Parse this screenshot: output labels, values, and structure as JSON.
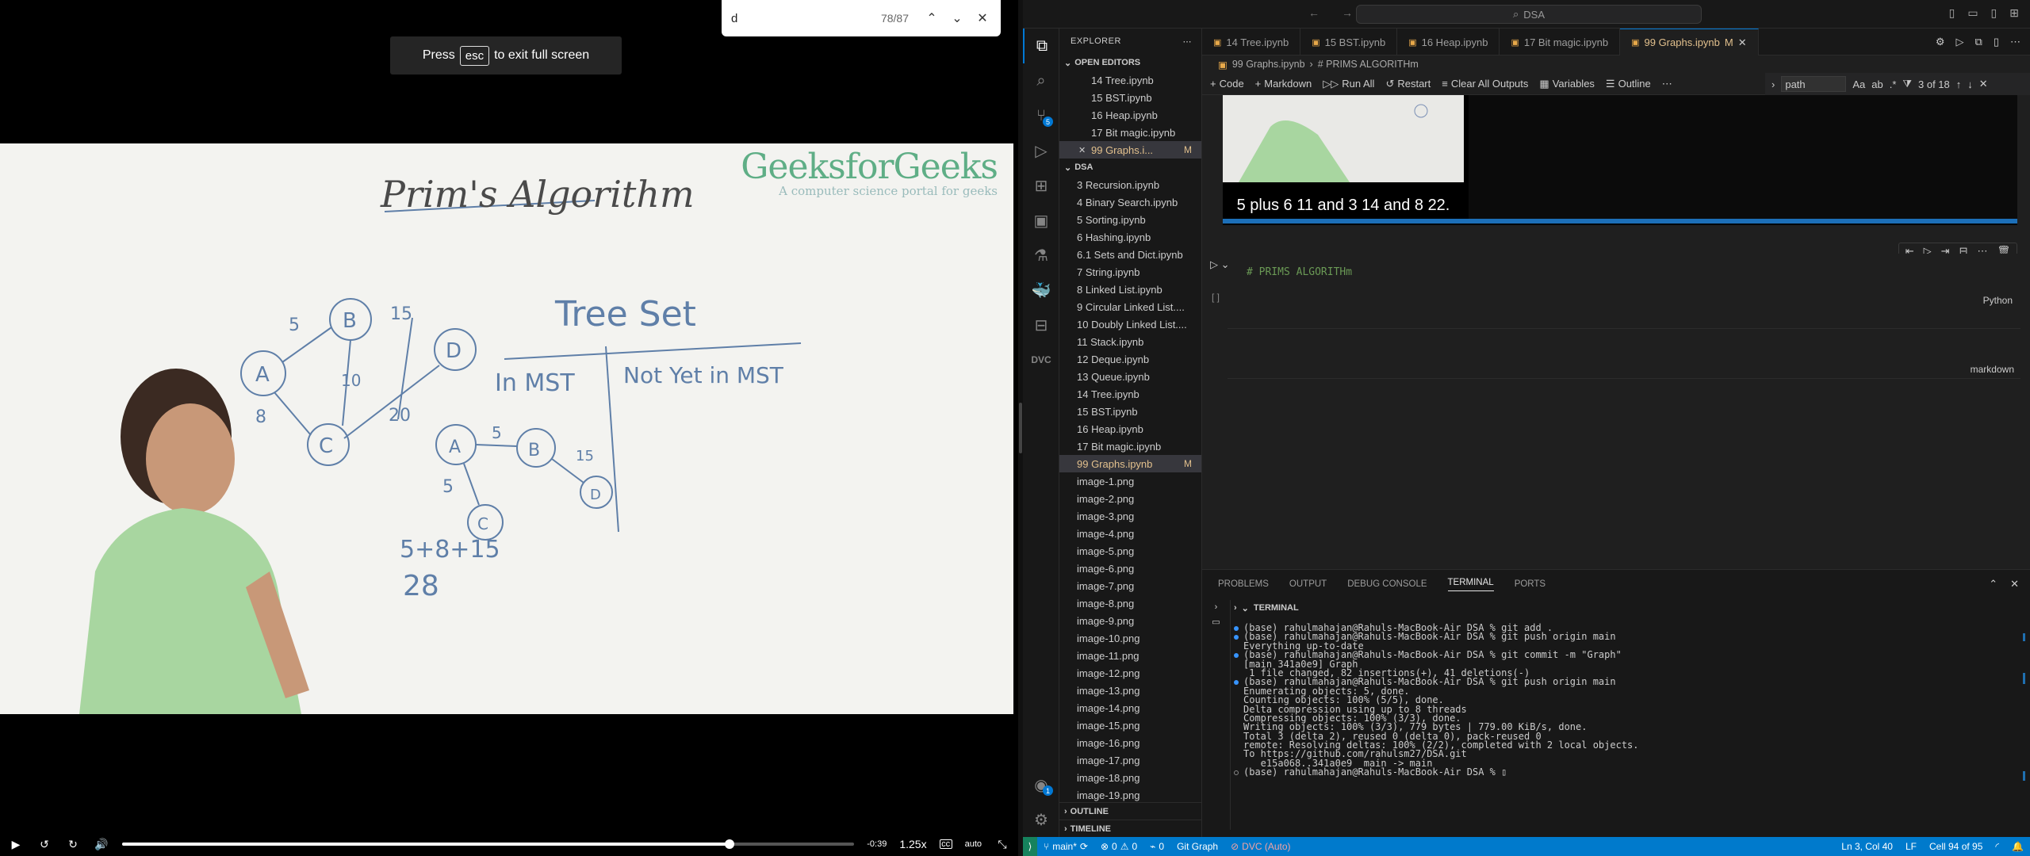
{
  "find_bar": {
    "query": "d",
    "count": "78/87"
  },
  "fullscreen_hint": {
    "before": "Press",
    "key": "esc",
    "after": "to exit full screen"
  },
  "video": {
    "brand_name": "GeeksforGeeks",
    "brand_tagline": "A computer science portal for geeks",
    "whiteboard": {
      "title": "Prim's Algorithm",
      "tree_set": "Tree Set",
      "in_mst": "In MST",
      "not_in_mst": "Not Yet in MST",
      "sum": "5+8+15",
      "total": "28",
      "nodes": [
        "A",
        "B",
        "C",
        "D"
      ],
      "edge_weights": [
        "5",
        "15",
        "10",
        "8",
        "20"
      ]
    },
    "time_remaining": "-0:39",
    "speed": "1.25x",
    "quality": "auto",
    "progress": 0.83
  },
  "vscode": {
    "search": "DSA",
    "explorer_label": "EXPLORER",
    "open_editors_label": "OPEN EDITORS",
    "open_editors": [
      {
        "name": "14 Tree.ipynb",
        "active": false,
        "mod": ""
      },
      {
        "name": "15 BST.ipynb",
        "active": false,
        "mod": ""
      },
      {
        "name": "16 Heap.ipynb",
        "active": false,
        "mod": ""
      },
      {
        "name": "17 Bit magic.ipynb",
        "active": false,
        "mod": ""
      },
      {
        "name": "99 Graphs.i...",
        "active": true,
        "mod": "M"
      }
    ],
    "folder_label": "DSA",
    "files": [
      {
        "name": "3 Recursion.ipynb",
        "active": false,
        "mod": ""
      },
      {
        "name": "4 Binary Search.ipynb",
        "active": false,
        "mod": ""
      },
      {
        "name": "5 Sorting.ipynb",
        "active": false,
        "mod": ""
      },
      {
        "name": "6 Hashing.ipynb",
        "active": false,
        "mod": ""
      },
      {
        "name": "6.1 Sets and Dict.ipynb",
        "active": false,
        "mod": ""
      },
      {
        "name": "7 String.ipynb",
        "active": false,
        "mod": ""
      },
      {
        "name": "8 Linked List.ipynb",
        "active": false,
        "mod": ""
      },
      {
        "name": "9 Circular Linked List....",
        "active": false,
        "mod": ""
      },
      {
        "name": "10 Doubly Linked List....",
        "active": false,
        "mod": ""
      },
      {
        "name": "11 Stack.ipynb",
        "active": false,
        "mod": ""
      },
      {
        "name": "12 Deque.ipynb",
        "active": false,
        "mod": ""
      },
      {
        "name": "13 Queue.ipynb",
        "active": false,
        "mod": ""
      },
      {
        "name": "14 Tree.ipynb",
        "active": false,
        "mod": ""
      },
      {
        "name": "15 BST.ipynb",
        "active": false,
        "mod": ""
      },
      {
        "name": "16 Heap.ipynb",
        "active": false,
        "mod": ""
      },
      {
        "name": "17 Bit magic.ipynb",
        "active": false,
        "mod": ""
      },
      {
        "name": "99 Graphs.ipynb",
        "active": true,
        "mod": "M"
      },
      {
        "name": "image-1.png",
        "active": false,
        "mod": ""
      },
      {
        "name": "image-2.png",
        "active": false,
        "mod": ""
      },
      {
        "name": "image-3.png",
        "active": false,
        "mod": ""
      },
      {
        "name": "image-4.png",
        "active": false,
        "mod": ""
      },
      {
        "name": "image-5.png",
        "active": false,
        "mod": ""
      },
      {
        "name": "image-6.png",
        "active": false,
        "mod": ""
      },
      {
        "name": "image-7.png",
        "active": false,
        "mod": ""
      },
      {
        "name": "image-8.png",
        "active": false,
        "mod": ""
      },
      {
        "name": "image-9.png",
        "active": false,
        "mod": ""
      },
      {
        "name": "image-10.png",
        "active": false,
        "mod": ""
      },
      {
        "name": "image-11.png",
        "active": false,
        "mod": ""
      },
      {
        "name": "image-12.png",
        "active": false,
        "mod": ""
      },
      {
        "name": "image-13.png",
        "active": false,
        "mod": ""
      },
      {
        "name": "image-14.png",
        "active": false,
        "mod": ""
      },
      {
        "name": "image-15.png",
        "active": false,
        "mod": ""
      },
      {
        "name": "image-16.png",
        "active": false,
        "mod": ""
      },
      {
        "name": "image-17.png",
        "active": false,
        "mod": ""
      },
      {
        "name": "image-18.png",
        "active": false,
        "mod": ""
      },
      {
        "name": "image-19.png",
        "active": false,
        "mod": ""
      }
    ],
    "outline_label": "OUTLINE",
    "timeline_label": "TIMELINE",
    "tabs": [
      {
        "name": "14 Tree.ipynb",
        "active": false,
        "mod": ""
      },
      {
        "name": "15 BST.ipynb",
        "active": false,
        "mod": ""
      },
      {
        "name": "16 Heap.ipynb",
        "active": false,
        "mod": ""
      },
      {
        "name": "17 Bit magic.ipynb",
        "active": false,
        "mod": ""
      },
      {
        "name": "99 Graphs.ipynb",
        "active": true,
        "mod": "M"
      }
    ],
    "breadcrumb": {
      "file": "99 Graphs.ipynb",
      "section": "# PRIMS ALGORITHm"
    },
    "toolbar": {
      "code": "Code",
      "markdown": "Markdown",
      "run_all": "Run All",
      "restart": "Restart",
      "clear": "Clear All Outputs",
      "variables": "Variables",
      "outline": "Outline"
    },
    "find_widget": {
      "query": "path",
      "aa": "Aa",
      "result": "3 of 18"
    },
    "output_subtitle": "5 plus 6 11 and 3 14 and 8 22.",
    "cell1": {
      "source": "# PRIMS ALGORITHm",
      "exec": "[ ]",
      "lang": "Python"
    },
    "cell2": {
      "lang": "markdown"
    },
    "panel_tabs": [
      "PROBLEMS",
      "OUTPUT",
      "DEBUG CONSOLE",
      "TERMINAL",
      "PORTS"
    ],
    "terminal_label": "TERMINAL",
    "terminal_lines": [
      {
        "dot": "blue",
        "text": "(base) rahulmahajan@Rahuls-MacBook-Air DSA % git add ."
      },
      {
        "dot": "blue",
        "text": "(base) rahulmahajan@Rahuls-MacBook-Air DSA % git push origin main"
      },
      {
        "dot": "",
        "text": "Everything up-to-date"
      },
      {
        "dot": "blue",
        "text": "(base) rahulmahajan@Rahuls-MacBook-Air DSA % git commit -m \"Graph\""
      },
      {
        "dot": "",
        "text": "[main 341a0e9] Graph"
      },
      {
        "dot": "",
        "text": " 1 file changed, 82 insertions(+), 41 deletions(-)"
      },
      {
        "dot": "blue",
        "text": "(base) rahulmahajan@Rahuls-MacBook-Air DSA % git push origin main"
      },
      {
        "dot": "",
        "text": "Enumerating objects: 5, done."
      },
      {
        "dot": "",
        "text": "Counting objects: 100% (5/5), done."
      },
      {
        "dot": "",
        "text": "Delta compression using up to 8 threads"
      },
      {
        "dot": "",
        "text": "Compressing objects: 100% (3/3), done."
      },
      {
        "dot": "",
        "text": "Writing objects: 100% (3/3), 779 bytes | 779.00 KiB/s, done."
      },
      {
        "dot": "",
        "text": "Total 3 (delta 2), reused 0 (delta 0), pack-reused 0"
      },
      {
        "dot": "",
        "text": "remote: Resolving deltas: 100% (2/2), completed with 2 local objects."
      },
      {
        "dot": "",
        "text": "To https://github.com/rahulsm27/DSA.git"
      },
      {
        "dot": "",
        "text": "   e15a068..341a0e9  main -> main"
      },
      {
        "dot": "grey",
        "text": "(base) rahulmahajan@Rahuls-MacBook-Air DSA % ▯"
      }
    ],
    "status": {
      "branch": "main*",
      "errors": "0",
      "warnings": "0",
      "ports": "0",
      "git_graph": "Git Graph",
      "dvc": "DVC (Auto)",
      "position": "Ln 3, Col 40",
      "eol": "LF",
      "cell": "Cell 94 of 95"
    },
    "badges": {
      "source_control": "5",
      "accounts": "1"
    }
  }
}
